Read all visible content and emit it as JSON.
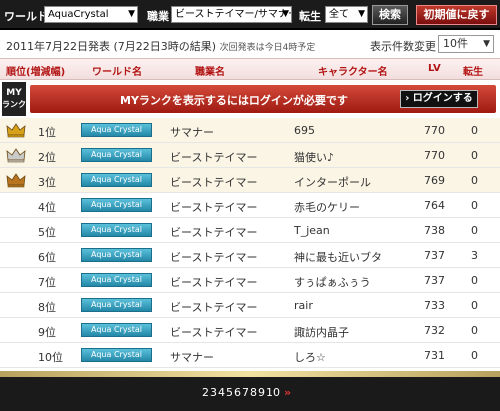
{
  "filters": {
    "world_label": "ワールド",
    "world_value": "AquaCrystal",
    "job_label": "職業",
    "job_value": "ビーストテイマー/サマナー",
    "rebirth_label": "転生",
    "rebirth_value": "全て",
    "search_button": "検索",
    "reset_button": "初期値に戻す"
  },
  "info": {
    "announce": "2011年7月22日発表 (7月22日3時の結果)",
    "next_announce": "次回発表は今日4時予定",
    "count_label": "表示件数変更",
    "count_value": "10件"
  },
  "headers": {
    "rank": "順位(増減幅)",
    "world": "ワールド名",
    "job": "職業名",
    "character": "キャラクター名",
    "lv": "LV",
    "rebirth": "転生"
  },
  "my_rank": {
    "badge_line1": "MY",
    "badge_line2": "ランク",
    "message": "MYランクを表示するにはログインが必要です",
    "login_button": "ログインする"
  },
  "rows": [
    {
      "rank": "1位",
      "world": "Aqua Crystal",
      "job": "サマナー",
      "name": "695",
      "lv": "770",
      "rebirth": "0"
    },
    {
      "rank": "2位",
      "world": "Aqua Crystal",
      "job": "ビーストテイマー",
      "name": "猫使い♪",
      "lv": "770",
      "rebirth": "0"
    },
    {
      "rank": "3位",
      "world": "Aqua Crystal",
      "job": "ビーストテイマー",
      "name": "インターポール",
      "lv": "769",
      "rebirth": "0"
    },
    {
      "rank": "4位",
      "world": "Aqua Crystal",
      "job": "ビーストテイマー",
      "name": "赤毛のケリー",
      "lv": "764",
      "rebirth": "0"
    },
    {
      "rank": "5位",
      "world": "Aqua Crystal",
      "job": "ビーストテイマー",
      "name": "T_jean",
      "lv": "738",
      "rebirth": "0"
    },
    {
      "rank": "6位",
      "world": "Aqua Crystal",
      "job": "ビーストテイマー",
      "name": "神に最も近いブタ",
      "lv": "737",
      "rebirth": "3"
    },
    {
      "rank": "7位",
      "world": "Aqua Crystal",
      "job": "ビーストテイマー",
      "name": "すぅぱぁふぅう",
      "lv": "737",
      "rebirth": "0"
    },
    {
      "rank": "8位",
      "world": "Aqua Crystal",
      "job": "ビーストテイマー",
      "name": "rair",
      "lv": "733",
      "rebirth": "0"
    },
    {
      "rank": "9位",
      "world": "Aqua Crystal",
      "job": "ビーストテイマー",
      "name": "諏訪内晶子",
      "lv": "732",
      "rebirth": "0"
    },
    {
      "rank": "10位",
      "world": "Aqua Crystal",
      "job": "サマナー",
      "name": "しろ☆",
      "lv": "731",
      "rebirth": "0"
    }
  ],
  "crowns": [
    "#d7a21a",
    "#c9c9c9",
    "#b8741f"
  ],
  "pager": {
    "pages": [
      "2",
      "3",
      "4",
      "5",
      "6",
      "7",
      "8",
      "9",
      "10"
    ],
    "next": "»"
  }
}
